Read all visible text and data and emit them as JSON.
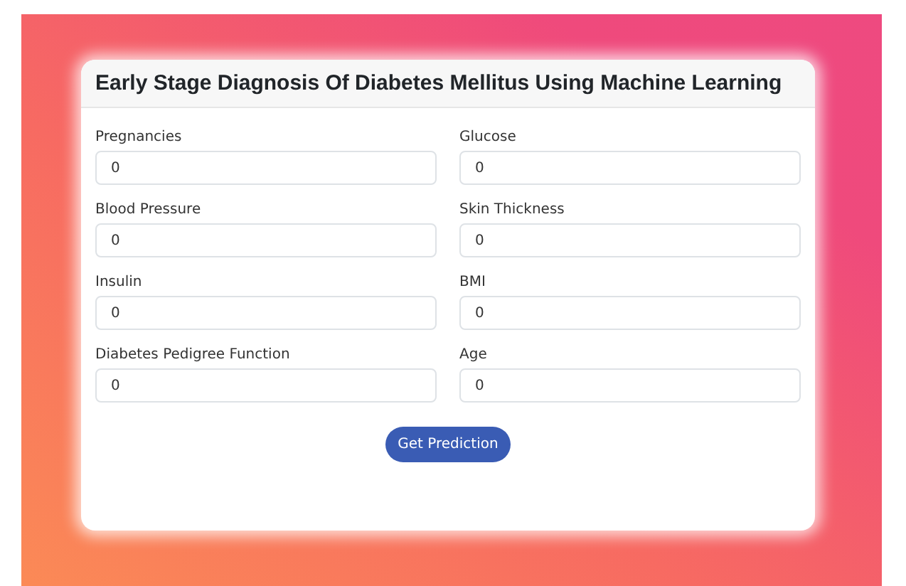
{
  "card": {
    "title": "Early Stage Diagnosis Of Diabetes Mellitus Using Machine Learning"
  },
  "fields": [
    {
      "label": "Pregnancies",
      "value": "0"
    },
    {
      "label": "Glucose",
      "value": "0"
    },
    {
      "label": "Blood Pressure",
      "value": "0"
    },
    {
      "label": "Skin Thickness",
      "value": "0"
    },
    {
      "label": "Insulin",
      "value": "0"
    },
    {
      "label": "BMI",
      "value": "0"
    },
    {
      "label": "Diabetes Pedigree Function",
      "value": "0"
    },
    {
      "label": "Age",
      "value": "0"
    }
  ],
  "button": {
    "label": "Get Prediction"
  }
}
